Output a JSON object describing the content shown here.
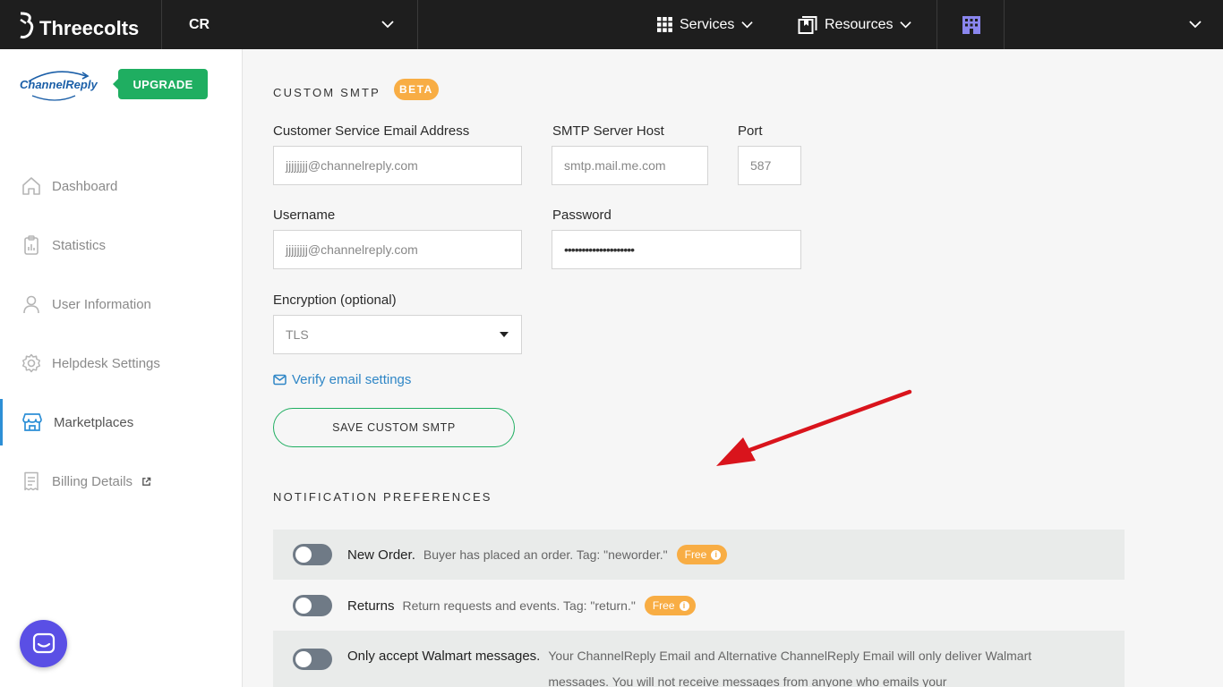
{
  "topbar": {
    "brand": "Threecolts",
    "account": "CR",
    "services_label": "Services",
    "resources_label": "Resources"
  },
  "sidebar": {
    "logo_text": "ChannelReply",
    "upgrade_label": "UPGRADE",
    "items": [
      {
        "label": "Dashboard"
      },
      {
        "label": "Statistics"
      },
      {
        "label": "User Information"
      },
      {
        "label": "Helpdesk Settings"
      },
      {
        "label": "Marketplaces"
      },
      {
        "label": "Billing Details"
      }
    ]
  },
  "smtp": {
    "title": "CUSTOM SMTP",
    "badge": "BETA",
    "email_label": "Customer Service Email Address",
    "email_value": "jjjjjjjj@channelreply.com",
    "host_label": "SMTP Server Host",
    "host_value": "smtp.mail.me.com",
    "port_label": "Port",
    "port_value": "587",
    "username_label": "Username",
    "username_value": "jjjjjjjj@channelreply.com",
    "password_label": "Password",
    "password_value": "••••••••••••••••••••",
    "encryption_label": "Encryption (optional)",
    "encryption_value": "TLS",
    "verify_label": "Verify email settings",
    "save_label": "SAVE CUSTOM SMTP"
  },
  "notifications": {
    "title": "NOTIFICATION PREFERENCES",
    "items": [
      {
        "title": "New Order.",
        "desc": "Buyer has placed an order. Tag: \"neworder.\"",
        "badge": "Free"
      },
      {
        "title": "Returns",
        "desc": "Return requests and events. Tag: \"return.\"",
        "badge": "Free"
      },
      {
        "title": "Only accept Walmart messages.",
        "desc": "Your ChannelReply Email and Alternative ChannelReply Email will only deliver Walmart messages. You will not receive messages from anyone who emails your"
      }
    ]
  },
  "colors": {
    "accent_green": "#1fae61",
    "badge_orange": "#f8ad44",
    "link_blue": "#2f86c6",
    "chat_purple": "#5a4fe5"
  }
}
